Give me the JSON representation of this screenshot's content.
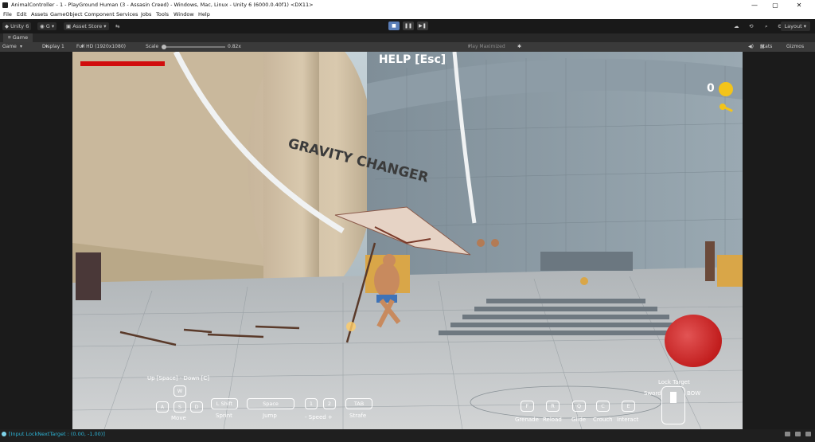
{
  "window": {
    "title": "AnimalController - 1 - PlayGround Human (3 - Assasin Creed) - Windows, Mac, Linux - Unity 6 (6000.0.40f1) <DX11>",
    "minimize": "—",
    "maximize": "▢",
    "close": "✕"
  },
  "menu": [
    "File",
    "Edit",
    "Assets",
    "GameObject",
    "Component",
    "Services",
    "Jobs",
    "Tools",
    "Window",
    "Help"
  ],
  "toolbar": {
    "unity_label": "Unity 6",
    "account_label": "G",
    "asset_store_label": "Asset Store",
    "layout_label": "Layout"
  },
  "tab": {
    "game_label": "Game"
  },
  "gamebar": {
    "view_label": "Game",
    "display_label": "Display 1",
    "resolution_label": "Full HD (1920x1080)",
    "scale_label": "Scale",
    "scale_value": "0.82x",
    "play_mode_label": "Play Maximized",
    "stats_label": "Stats",
    "gizmos_label": "Gizmos"
  },
  "hud": {
    "help_text": "HELP [Esc]",
    "coin_count": "0",
    "scene_sign": "GRAVITY CHANGER",
    "up_down_hint": "Up [Space] - Down [C]",
    "keys": {
      "w": "W",
      "a": "A",
      "s": "S",
      "d": "D",
      "shift": "L Shift",
      "space": "Space",
      "one": "1",
      "two": "2",
      "tab": "TAB",
      "f": "F",
      "r": "R",
      "q": "Q",
      "c": "C",
      "e": "E"
    },
    "labels": {
      "move": "Move",
      "sprint": "Sprint",
      "jump": "Jump",
      "speed": "- Speed +",
      "strafe": "Strafe",
      "grenade": "Grenade",
      "reload": "Reload",
      "glide": "Glide",
      "crouch": "Crouch",
      "interact": "Interact",
      "lock_target": "Lock Target",
      "sword": "Sword",
      "bow": "BOW"
    }
  },
  "status": {
    "message": "[Input LockNextTarget : (0.00, -1.00)]"
  },
  "colors": {
    "accent": "#5a7eb8",
    "health": "#d10d0d",
    "coin": "#f3c41a",
    "status": "#2db4d6"
  }
}
